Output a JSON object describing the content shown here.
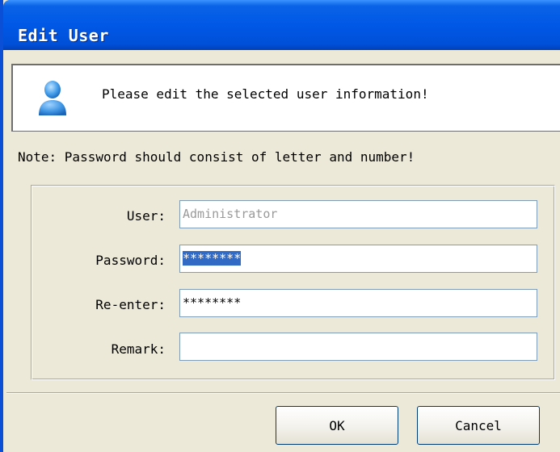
{
  "window": {
    "title": "Edit User"
  },
  "banner": {
    "message": "Please edit the selected user information!",
    "icon": "user-icon"
  },
  "note": "Note: Password should consist of letter and number!",
  "form": {
    "user": {
      "label": "User:",
      "value": "Administrator",
      "disabled": true
    },
    "password": {
      "label": "Password:",
      "value": "********",
      "selected": true
    },
    "reenter": {
      "label": "Re-enter:",
      "value": "********"
    },
    "remark": {
      "label": "Remark:",
      "value": ""
    }
  },
  "buttons": {
    "ok": "OK",
    "cancel": "Cancel"
  },
  "colors": {
    "titlebar": "#0058e6",
    "selection": "#316ac5",
    "dialog_bg": "#ece9d8"
  }
}
